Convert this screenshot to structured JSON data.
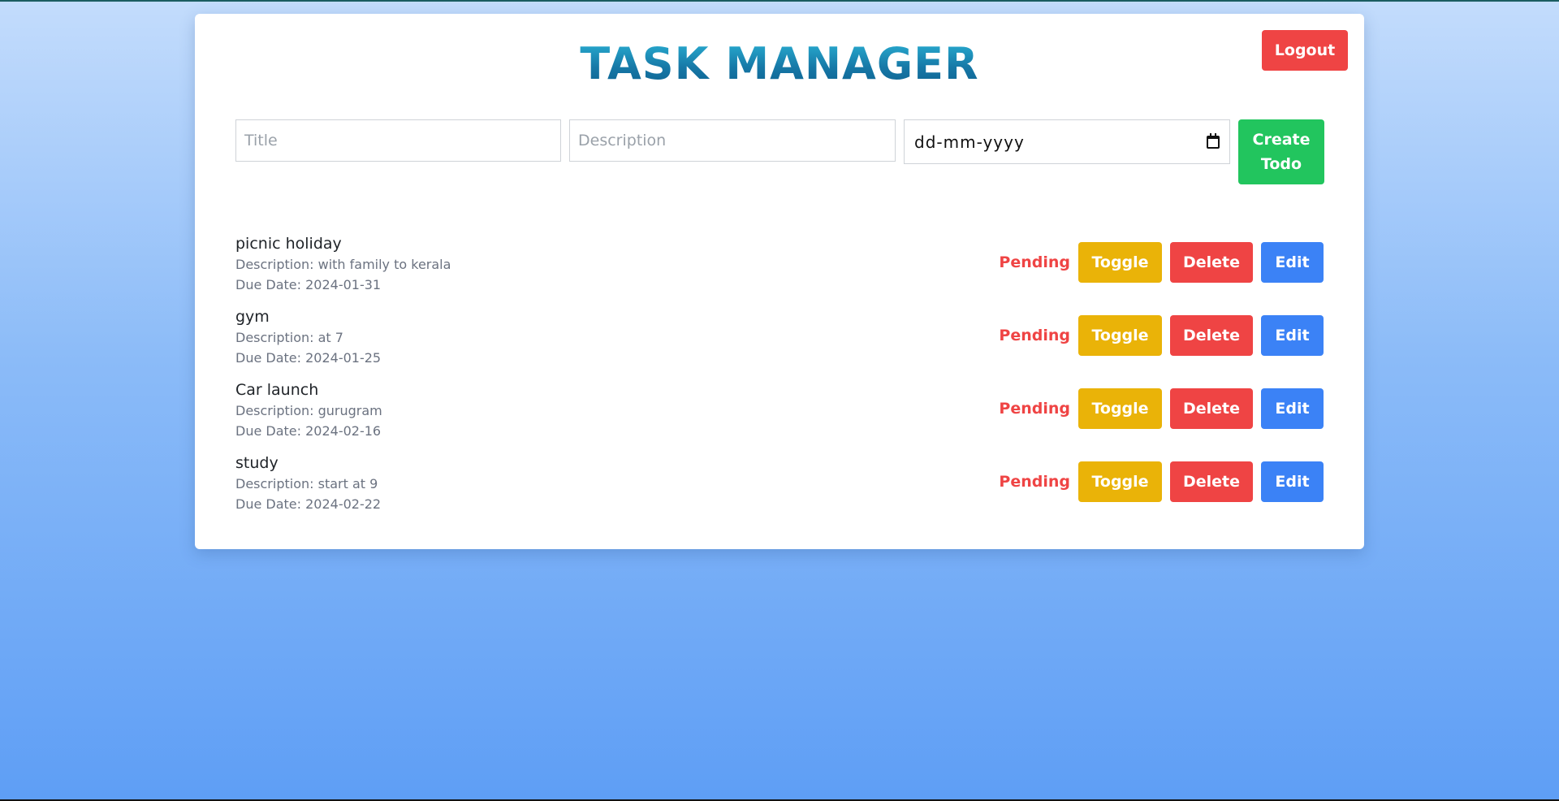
{
  "header": {
    "title": "TASK MANAGER",
    "logout_label": "Logout"
  },
  "form": {
    "title_placeholder": "Title",
    "description_placeholder": "Description",
    "date_placeholder": "dd-mm-yyyy",
    "create_label": "Create Todo"
  },
  "todos": [
    {
      "title": "picnic holiday",
      "description": "Description: with family to kerala",
      "due": "Due Date: 2024-01-31",
      "status": "Pending"
    },
    {
      "title": "gym",
      "description": "Description: at 7",
      "due": "Due Date: 2024-01-25",
      "status": "Pending"
    },
    {
      "title": "Car launch",
      "description": "Description: gurugram",
      "due": "Due Date: 2024-02-16",
      "status": "Pending"
    },
    {
      "title": "study",
      "description": "Description: start at 9",
      "due": "Due Date: 2024-02-22",
      "status": "Pending"
    }
  ],
  "actions": {
    "toggle_label": "Toggle",
    "delete_label": "Delete",
    "edit_label": "Edit"
  },
  "colors": {
    "logout": "#ef4444",
    "create": "#22c55e",
    "toggle": "#eab308",
    "delete": "#ef4444",
    "edit": "#3b82f6",
    "status_pending": "#ef4444"
  }
}
